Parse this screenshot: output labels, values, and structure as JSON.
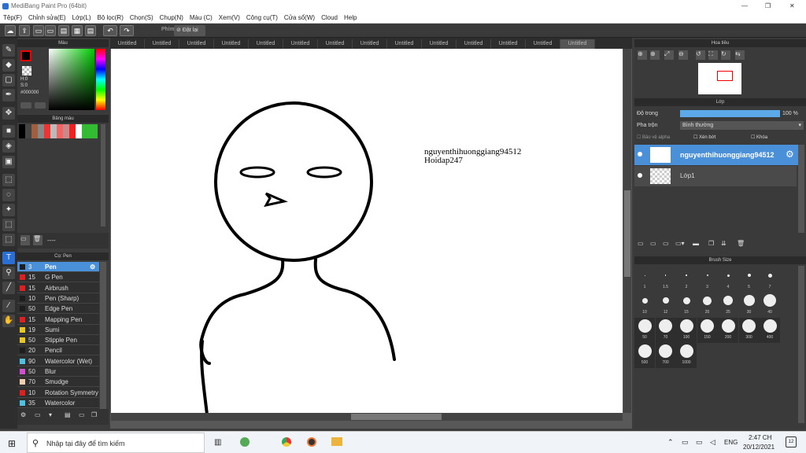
{
  "window": {
    "title": "MediBang Paint Pro (64bit)",
    "min": "—",
    "max": "❐",
    "close": "✕"
  },
  "menu": [
    "Tệp(F)",
    "Chỉnh sửa(E)",
    "Lớp(L)",
    "Bộ lọc(R)",
    "Chọn(S)",
    "Chụp(N)",
    "Màu (C)",
    "Xem(V)",
    "Công cụ(T)",
    "Cửa sổ(W)",
    "Cloud",
    "Help"
  ],
  "toolbar": {
    "phim_label": "Phím",
    "reset_label": "Đặt lại"
  },
  "color_panel": {
    "title": "Màu",
    "h": "H:0",
    "s": "S:0",
    "hex": "#000000"
  },
  "palette_panel": {
    "title": "Bảng màu",
    "dots": "----"
  },
  "brush_panel": {
    "title": "Cọ: Pen",
    "brushes": [
      {
        "size": "3",
        "name": "Pen",
        "color": "#1d1d1d"
      },
      {
        "size": "15",
        "name": "G Pen",
        "color": "#e02020"
      },
      {
        "size": "15",
        "name": "Airbrush",
        "color": "#e02020"
      },
      {
        "size": "10",
        "name": "Pen (Sharp)",
        "color": "#1d1d1d"
      },
      {
        "size": "50",
        "name": "Edge Pen",
        "color": "#1d1d1d"
      },
      {
        "size": "15",
        "name": "Mapping Pen",
        "color": "#e02020"
      },
      {
        "size": "19",
        "name": "Sumi",
        "color": "#e8c820"
      },
      {
        "size": "50",
        "name": "Stipple Pen",
        "color": "#e8c820"
      },
      {
        "size": "20",
        "name": "Pencil",
        "color": "#1d1d1d"
      },
      {
        "size": "90",
        "name": "Watercolor (Wet)",
        "color": "#50c0e0"
      },
      {
        "size": "50",
        "name": "Blur",
        "color": "#d050d0"
      },
      {
        "size": "70",
        "name": "Smudge",
        "color": "#f0d0b0"
      },
      {
        "size": "10",
        "name": "Rotation Symmetry",
        "color": "#e02020"
      },
      {
        "size": "35",
        "name": "Watercolor",
        "color": "#50c0e0"
      }
    ]
  },
  "tabs": [
    "Untitled",
    "Untitled",
    "Untitled",
    "Untitled",
    "Untitled",
    "Untitled",
    "Untitled",
    "Untitled",
    "Untitled",
    "Untitled",
    "Untitled",
    "Untitled",
    "Untitled",
    "Untitled"
  ],
  "canvas_text": {
    "line1": "nguyenthihuonggiang94512",
    "line2": "Hoidap247"
  },
  "navigator": {
    "title": "Hoa tiêu"
  },
  "layer_panel": {
    "title": "Lớp",
    "opacity_label": "Độ trong",
    "opacity_value": "100 %",
    "opacity": 1.0,
    "blend_label": "Pha trộn",
    "blend_value": "Bình thường",
    "protect_alpha": "Bảo vệ alpha",
    "clipping": "Xén bớt",
    "lock": "Khóa",
    "layers": [
      {
        "name": "nguyenthihuonggiang94512",
        "selected": true
      },
      {
        "name": "Lớp1",
        "selected": false
      }
    ]
  },
  "brushsize_panel": {
    "title": "Brush Size",
    "sizes": [
      "1",
      "1.5",
      "2",
      "3",
      "4",
      "5",
      "7",
      "10",
      "12",
      "15",
      "20",
      "25",
      "30",
      "40",
      "50",
      "70",
      "100",
      "150",
      "200",
      "300",
      "400",
      "500",
      "700",
      "1000"
    ]
  },
  "taskbar": {
    "search_placeholder": "Nhập tại đây để tìm kiếm",
    "lang": "ENG",
    "time": "2:47 CH",
    "date": "20/12/2021",
    "notif": "12"
  }
}
